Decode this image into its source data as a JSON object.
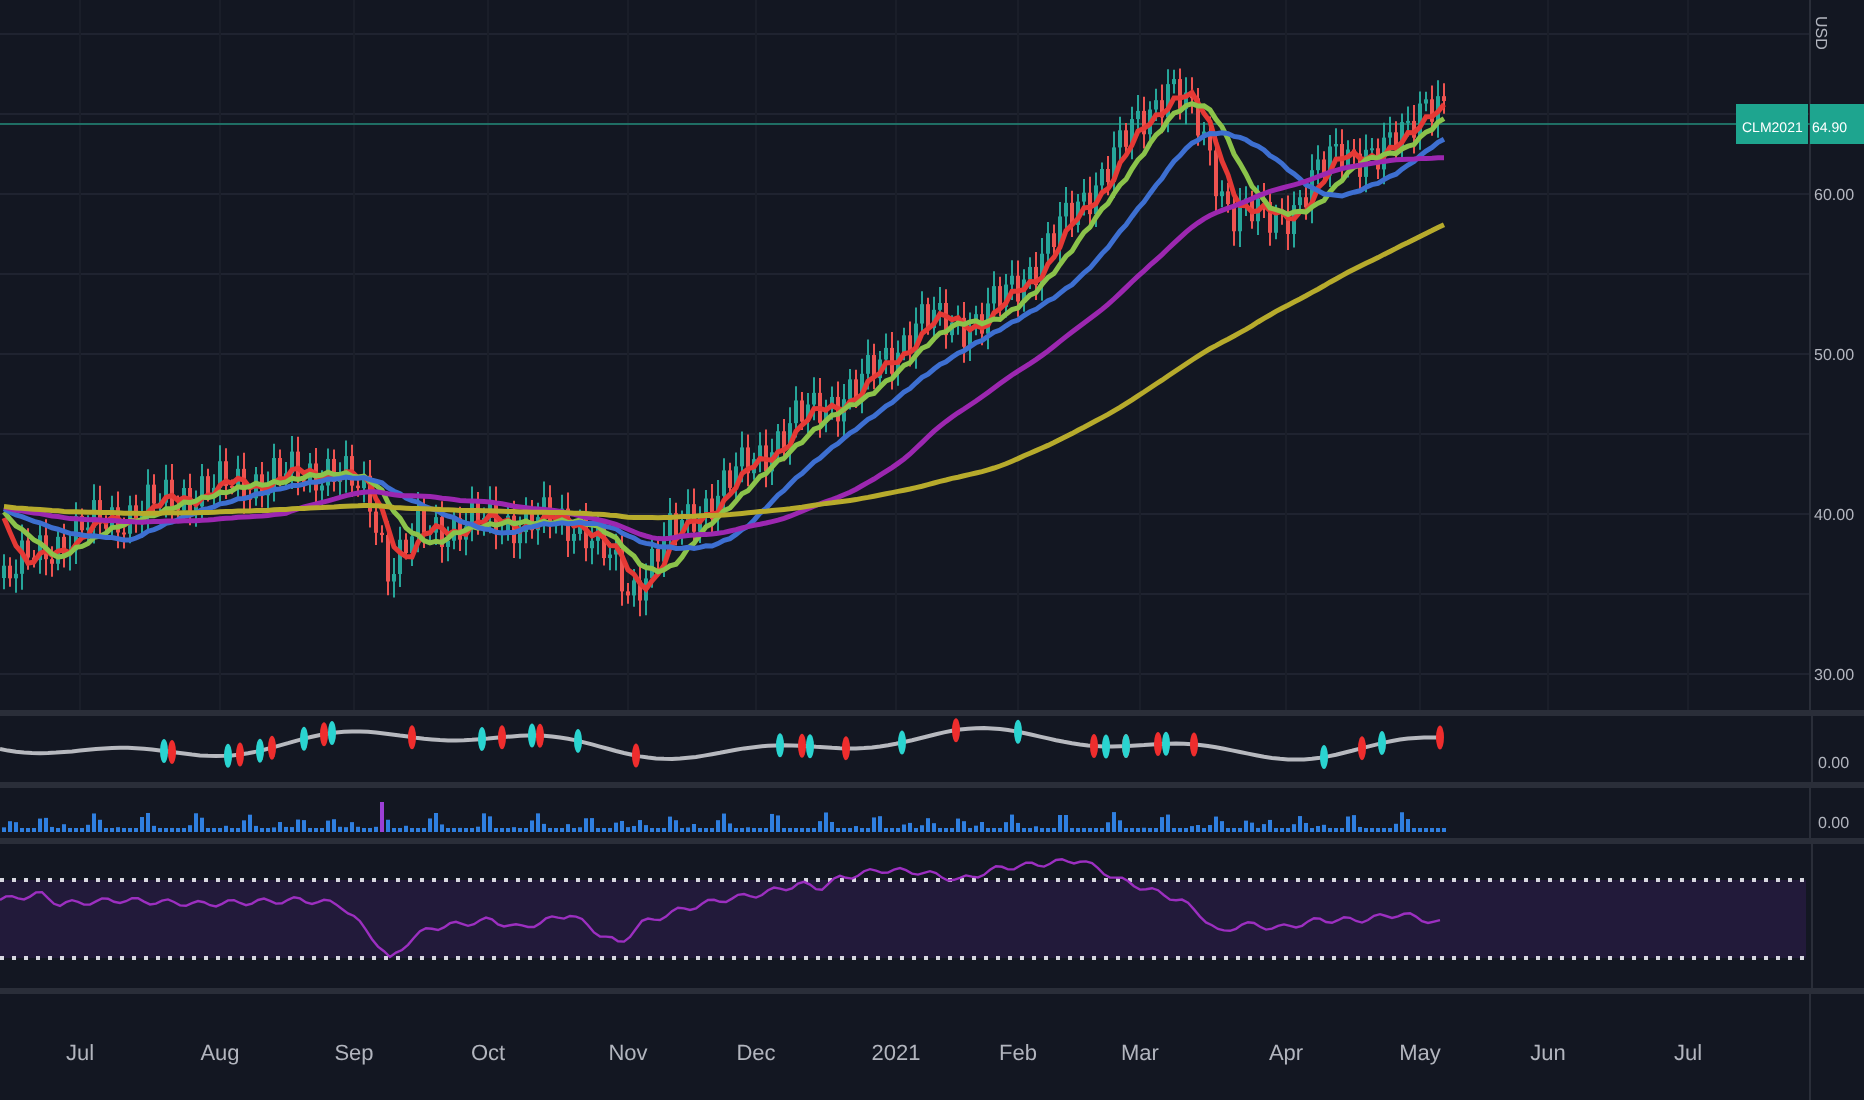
{
  "price_axis": {
    "currency": "USD",
    "ticks": [
      "60.00",
      "50.00",
      "40.00",
      "30.00"
    ]
  },
  "last_price": {
    "symbol": "CLM2021",
    "value": "64.90"
  },
  "indicator_panes": [
    {
      "reading": "0.00"
    },
    {
      "reading": "0.00"
    }
  ],
  "time_axis": {
    "labels": [
      "Jul",
      "Aug",
      "Sep",
      "Oct",
      "Nov",
      "Dec",
      "2021",
      "Feb",
      "Mar",
      "Apr",
      "May",
      "Jun",
      "Jul"
    ]
  }
}
